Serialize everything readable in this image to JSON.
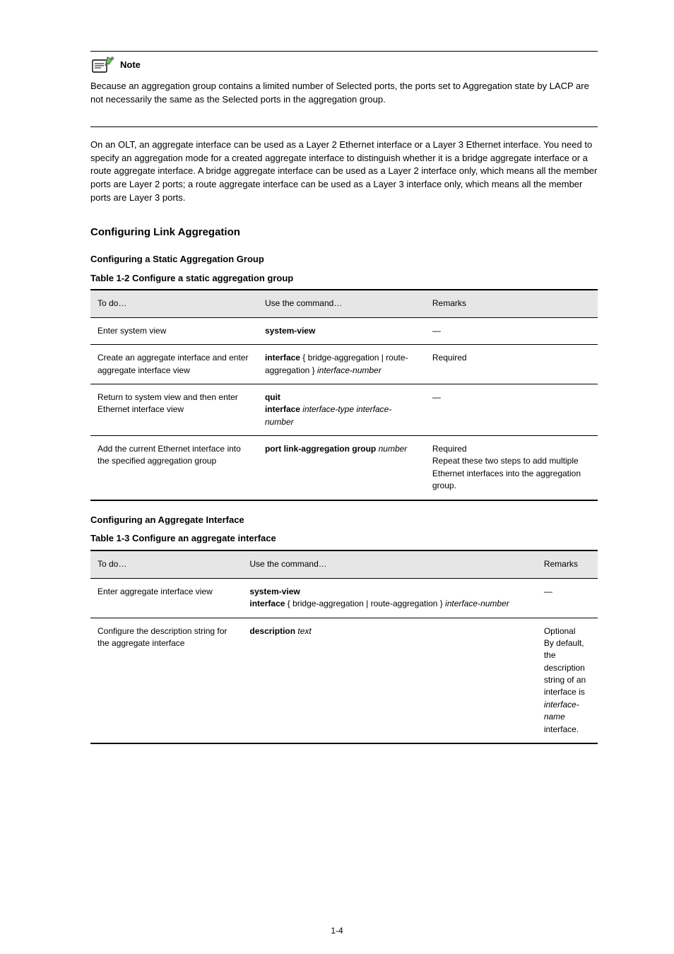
{
  "note": {
    "label": "Note",
    "body": "Because an aggregation group contains a limited number of Selected ports, the ports set to Aggregation state by LACP are not necessarily the same as the Selected ports in the aggregation group."
  },
  "paragraphs": {
    "p1": "On an OLT, an aggregate interface can be used as a Layer 2 Ethernet interface or a Layer 3 Ethernet interface. You need to specify an aggregation mode for a created aggregate interface to distinguish whether it is a bridge aggregate interface or a route aggregate interface. A bridge aggregate interface can be used as a Layer 2 interface only, which means all the member ports are Layer 2 ports; a route aggregate interface can be used as a Layer 3 interface only, which means all the member ports are Layer 3 ports."
  },
  "section": {
    "title": "Configuring Link Aggregation"
  },
  "subsection1": {
    "title": "Configuring a Static Aggregation Group",
    "caption": "Table 1-2 Configure a static aggregation group"
  },
  "table1": {
    "headers": [
      "To do…",
      "Use the command…",
      "Remarks"
    ],
    "rows": [
      {
        "c0": "Enter system view",
        "c1_bold": "system-view",
        "c1_rest": "",
        "c2": "—"
      },
      {
        "c0": "Create an aggregate interface and enter aggregate interface view",
        "c1_pre": "interface",
        "c1_mid": " { bridge-aggregation | route-aggregation } ",
        "c1_post": "interface-number",
        "c2": "Required"
      },
      {
        "c0": "Return to system view and then enter Ethernet interface view",
        "c1_line1_bold": "quit",
        "c1_line2_bold": "interface ",
        "c1_line2_ital": "interface-type interface-number",
        "c2": "—"
      },
      {
        "c0": "Add the current Ethernet interface into the specified aggregation group",
        "c1_bold": "port link-aggregation group ",
        "c1_ital": "number",
        "c2_line1": "Required",
        "c2_line2": "Repeat these two steps to add multiple Ethernet interfaces into the aggregation group."
      }
    ]
  },
  "subsection2": {
    "title": "Configuring an Aggregate Interface",
    "caption": "Table 1-3 Configure an aggregate interface"
  },
  "table2": {
    "headers": [
      "To do…",
      "Use the command…",
      "Remarks"
    ],
    "rows": [
      {
        "c0": "Enter aggregate interface view",
        "c1_line1_bold": "system-view",
        "c1_line2_pre": "interface",
        "c1_line2_mid": " { bridge-aggregation | route-aggregation } ",
        "c1_line2_ital": "interface-number",
        "c2": "—"
      },
      {
        "c0": "Configure the description string for the aggregate interface",
        "c1_bold": "description ",
        "c1_ital": "text",
        "c2_line1": "Optional",
        "c2_line2": "By default, the description string of an interface is ",
        "c2_line2_ital": "interface-name",
        "c2_line2_rest": " interface."
      }
    ]
  },
  "page_number": "1-4"
}
